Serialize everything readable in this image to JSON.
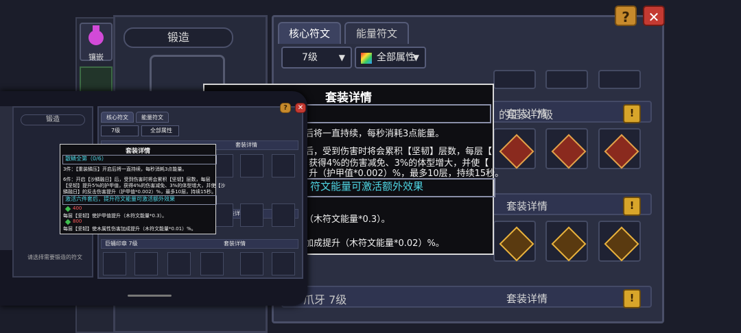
{
  "forge": {
    "title": "锻造",
    "side_label": "镶嵌",
    "hint": "请选择需要锻造的符文"
  },
  "tabs": {
    "core": "核心符文",
    "energy": "能量符文"
  },
  "buttons": {
    "help": "?",
    "close": "✕"
  },
  "filters": {
    "level": "7级",
    "attr": "全部属性"
  },
  "set_detail_label": "套装详情",
  "sets": [
    {
      "title_fragment": "的正义 7级"
    },
    {
      "title_fragment": "印章 7级"
    },
    {
      "title_fragment": "爪牙 7级"
    }
  ],
  "popup": {
    "title": "套装详情",
    "line1": "后将一直持续，每秒消耗3点能量。",
    "line2": "后，受到伤害时将会累积【坚韧】层数，每层【",
    "line3": "获得4%的伤害减免、3%的体型增大，并使【",
    "line4": "升（护甲值*0.002）%，最多10层，持续15秒。",
    "bar": "符文能量可激活额外效果",
    "line5": "（木符文能量*0.3）。",
    "line6": "加成提升（木符文能量*0.02）%。"
  },
  "overlay": {
    "forge_title": "锻造",
    "tab_core": "核心符文",
    "tab_energy": "能量符文",
    "level": "7级",
    "attr": "全部属性",
    "set_label": "套装详情",
    "set3_title": "巨蛹印章 7级",
    "popup_title": "套装详情",
    "set_name": "散鳞全第（0/6）",
    "p3": "3件：【重装鳞压】开启后将一直持续，每秒消耗3点能量。",
    "p6a": "6件：开启【沙鳞融日】后，受到伤害时将会累积【坚韧】层数，每层",
    "p6b": "【坚韧】提升5%的护甲值，获得4%的伤害减免、3%的体型增大，并使【沙",
    "p6c": "鳞融日】的反击伤害提升（护甲值*0.002）%，最多10层，持续15秒。",
    "bar": "激活六件套后，提升符文能量可激活额外效果",
    "e1": "400",
    "e1t": "每层【坚韧】使护甲值提升（木符文能量*0.3）。",
    "e2": "800",
    "e2t": "每层【坚韧】使木属性伤害加成提升（木符文能量*0.01）%。",
    "hint": "请选择需要锻造的符文"
  },
  "colors": {
    "accent_cyan": "#4fd6e4",
    "help_orange": "#c78a2c",
    "close_red": "#c43a32",
    "gem_green": "#3fbf4f"
  }
}
